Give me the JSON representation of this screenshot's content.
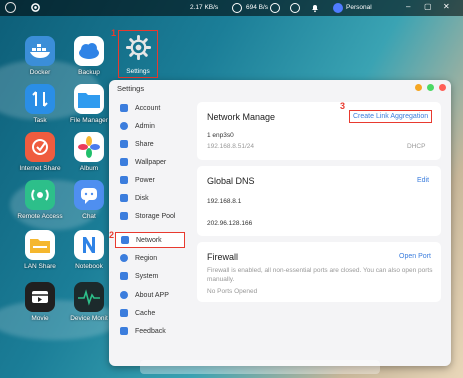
{
  "topbar": {
    "upload": "2.17 KB/s",
    "download": "694 B/s",
    "user": "Personal"
  },
  "desktop": {
    "apps": [
      {
        "label": "Docker",
        "icon": "docker-icon",
        "color": "#3b8ed8"
      },
      {
        "label": "Backup",
        "icon": "backup-cloud-icon",
        "color": "#2f83e6"
      },
      {
        "label": "Task",
        "icon": "task-icon",
        "color": "#2a8ee6"
      },
      {
        "label": "File Manager",
        "icon": "folder-icon",
        "color": "#2f9bef"
      },
      {
        "label": "Internet Share",
        "icon": "internet-share-icon",
        "color": "#ef5c3f"
      },
      {
        "label": "Album",
        "icon": "album-icon",
        "color": "#ffffff"
      },
      {
        "label": "Remote Access",
        "icon": "remote-access-icon",
        "color": "#2dbf8a"
      },
      {
        "label": "Chat",
        "icon": "chat-icon",
        "color": "#4f8ff0"
      },
      {
        "label": "LAN Share",
        "icon": "lan-share-icon",
        "color": "#f5b72e"
      },
      {
        "label": "Notebook",
        "icon": "notebook-icon",
        "color": "#2f83e6"
      },
      {
        "label": "Movie",
        "icon": "movie-icon",
        "color": "#202020"
      },
      {
        "label": "Device Monit",
        "icon": "device-monitor-icon",
        "color": "#1c2a2c"
      }
    ],
    "settings_label": "Settings"
  },
  "annotations": {
    "one": "1",
    "two": "2",
    "three": "3"
  },
  "window": {
    "title": "Settings",
    "sidebar": [
      {
        "label": "Account",
        "icon": "account-icon"
      },
      {
        "label": "Admin",
        "icon": "admin-icon"
      },
      {
        "label": "Share",
        "icon": "share-icon"
      },
      {
        "label": "Wallpaper",
        "icon": "wallpaper-icon"
      },
      {
        "label": "Power",
        "icon": "power-icon"
      },
      {
        "label": "Disk",
        "icon": "disk-icon"
      },
      {
        "label": "Storage Pool",
        "icon": "storage-pool-icon"
      },
      {
        "label": "Network",
        "icon": "network-icon"
      },
      {
        "label": "Region",
        "icon": "region-icon"
      },
      {
        "label": "System",
        "icon": "system-icon"
      },
      {
        "label": "About APP",
        "icon": "about-icon"
      },
      {
        "label": "Cache",
        "icon": "cache-icon"
      },
      {
        "label": "Feedback",
        "icon": "feedback-icon"
      }
    ],
    "network_manage": {
      "title": "Network Manage",
      "action": "Create Link Aggregation",
      "interface": "1 enp3s0",
      "ip": "192.168.8.51/24",
      "mode": "DHCP"
    },
    "global_dns": {
      "title": "Global DNS",
      "action": "Edit",
      "dns1": "192.168.8.1",
      "dns2": "202.96.128.166"
    },
    "firewall": {
      "title": "Firewall",
      "action": "Open Port",
      "desc": "Firewall is enabled, all non-essential ports are closed. You can also open ports manually.",
      "status": "No Ports Opened"
    }
  }
}
